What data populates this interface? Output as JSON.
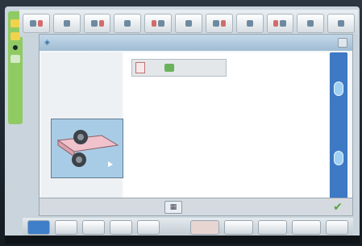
{
  "toolbar": {
    "buttons": [
      {
        "icon": "tool-icon"
      },
      {
        "icon": "tool-icon"
      },
      {
        "icon": "tool-icon"
      },
      {
        "icon": "tool-icon"
      },
      {
        "icon": "tool-icon"
      },
      {
        "icon": "tool-icon"
      },
      {
        "icon": "tool-icon"
      },
      {
        "icon": "tool-icon"
      },
      {
        "icon": "tool-icon"
      },
      {
        "icon": "tool-icon"
      },
      {
        "icon": "tool-icon"
      }
    ]
  },
  "dialog": {
    "title": "",
    "side_label": "",
    "footer_button": "▦"
  },
  "colors": {
    "accent_green": "#8fca63",
    "scroll_blue": "#3d79c4",
    "title_blue": "#9fbcd3"
  }
}
